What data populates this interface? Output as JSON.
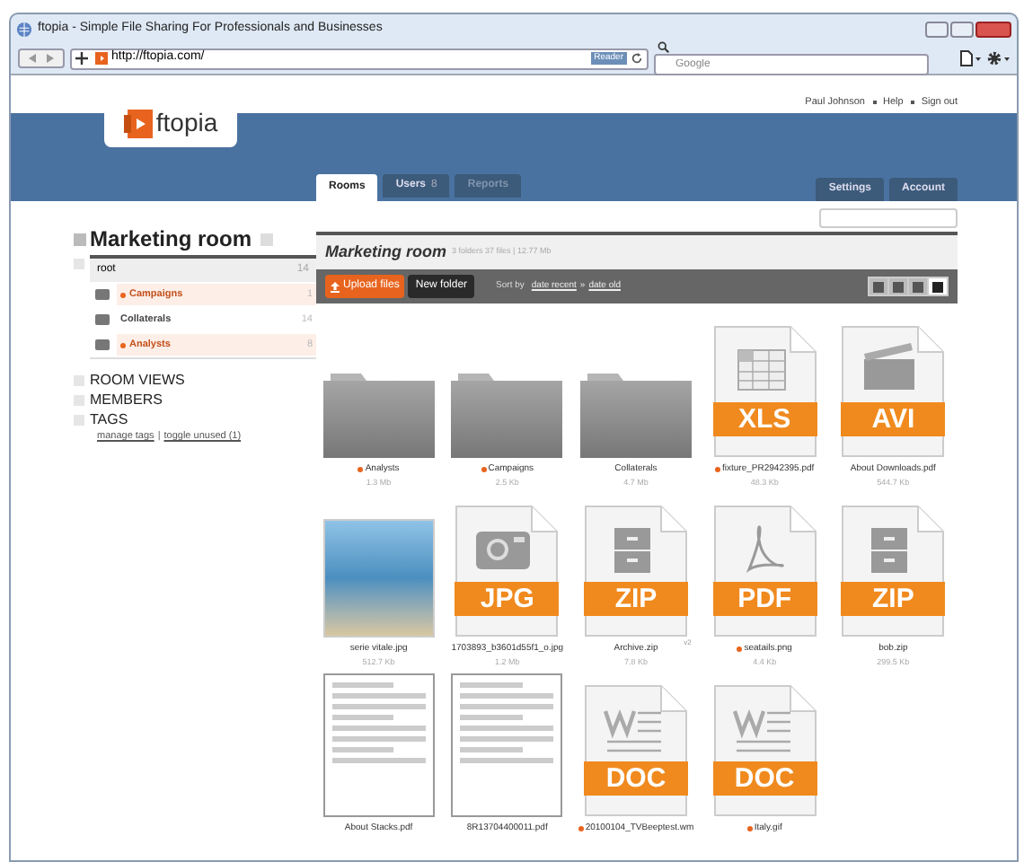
{
  "window": {
    "title": "ftopia - Simple File Sharing For Professionals and Businesses",
    "url": "http://ftopia.com/",
    "reader": "Reader",
    "search_placeholder": "Google"
  },
  "header": {
    "logo": "ftopia",
    "links": [
      "Paul Johnson",
      "Help",
      "Sign out"
    ]
  },
  "tabs": [
    {
      "label": "Rooms",
      "selected": true,
      "disabled": false
    },
    {
      "label": "Users",
      "count": "8",
      "selected": false,
      "disabled": false
    },
    {
      "label": "Reports",
      "selected": false,
      "disabled": true
    }
  ],
  "right_tabs": [
    "Settings",
    "Account"
  ],
  "sidebar": {
    "room": "Marketing room",
    "tree": {
      "label": "root",
      "count": "14",
      "children": [
        {
          "label": "Campaigns",
          "count": "1",
          "tagged": true
        },
        {
          "label": "Collaterals",
          "count": "14",
          "tagged": false
        },
        {
          "label": "Analysts",
          "count": "8",
          "tagged": true
        }
      ]
    },
    "sections": [
      "ROOM VIEWS",
      "MEMBERS",
      "TAGS"
    ],
    "tag_links": [
      "manage tags",
      "|",
      "toggle unused (1)"
    ]
  },
  "main": {
    "title": "Marketing room",
    "meta": "3 folders 37 files | 12.77 Mb",
    "upload": "Upload files",
    "new_folder": "New folder",
    "sort_label": "Sort by",
    "sort_links": [
      "date recent",
      "»",
      "date old"
    ],
    "views": [
      {
        "selected": false
      },
      {
        "selected": false
      },
      {
        "selected": false
      },
      {
        "selected": true
      }
    ],
    "files": [
      {
        "kind": "folder",
        "name": "Analysts",
        "size": "1.3 Mb",
        "tagged": true
      },
      {
        "kind": "folder",
        "name": "Campaigns",
        "size": "2.5 Kb",
        "tagged": true
      },
      {
        "kind": "folder",
        "name": "Collaterals",
        "size": "4.7 Mb",
        "tagged": false
      },
      {
        "kind": "sheet",
        "badge": "XLS",
        "name": "fixture_PR2942395.pdf",
        "size": "48.3 Kb",
        "tagged": true
      },
      {
        "kind": "video",
        "badge": "AVI",
        "name": "About Downloads.pdf",
        "size": "544.7 Kb",
        "tagged": false
      },
      {
        "kind": "photo",
        "name": "serie vitale.jpg",
        "size": "512.7 Kb",
        "tagged": false
      },
      {
        "kind": "camera",
        "badge": "JPG",
        "name": "1703893_b3601d55f1_o.jpg",
        "size": "1.2 Mb",
        "tagged": false
      },
      {
        "kind": "archive",
        "badge": "ZIP",
        "name": "Archive.zip",
        "size": "7.8 Kb",
        "tagged": false,
        "version": "v2"
      },
      {
        "kind": "acrobat",
        "badge": "PDF",
        "name": "seatails.png",
        "size": "4.4 Kb",
        "tagged": true
      },
      {
        "kind": "archive",
        "badge": "ZIP",
        "name": "bob.zip",
        "size": "299.5 Kb",
        "tagged": false
      },
      {
        "kind": "preview",
        "name": "About Stacks.pdf",
        "tagged": false
      },
      {
        "kind": "preview",
        "name": "8R13704400011.pdf",
        "tagged": false
      },
      {
        "kind": "word",
        "badge": "DOC",
        "name": "20100104_TVBeeptest.wm",
        "tagged": true
      },
      {
        "kind": "word",
        "badge": "DOC",
        "name": "Italy.gif",
        "tagged": true
      }
    ]
  }
}
